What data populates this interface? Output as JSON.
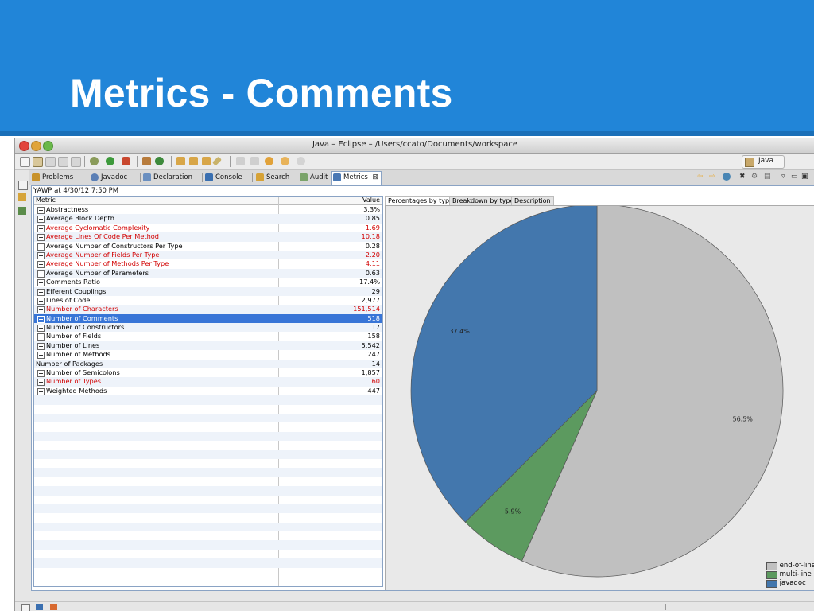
{
  "slide": {
    "title": "Metrics - Comments"
  },
  "window": {
    "title": "Java – Eclipse – /Users/ccato/Documents/workspace"
  },
  "perspective": {
    "label": "Java"
  },
  "tabs": [
    {
      "label": "Problems",
      "icon": "problems-icon",
      "color": "#c8922a"
    },
    {
      "label": "Javadoc",
      "icon": "javadoc-icon",
      "color": "#5b7fb5"
    },
    {
      "label": "Declaration",
      "icon": "declaration-icon",
      "color": "#6a8fc0"
    },
    {
      "label": "Console",
      "icon": "console-icon",
      "color": "#3a6fb0"
    },
    {
      "label": "Search",
      "icon": "search-icon",
      "color": "#d6a236"
    },
    {
      "label": "Audit",
      "icon": "audit-icon",
      "color": "#7aa36a"
    },
    {
      "label": "Metrics",
      "icon": "metrics-icon",
      "color": "#4a78b4"
    }
  ],
  "metrics": {
    "info": "YAWP at 4/30/12 7:50 PM",
    "columns": {
      "metric": "Metric",
      "value": "Value"
    },
    "rows": [
      {
        "name": "Abstractness",
        "value": "3.3%",
        "red": false,
        "expandable": true
      },
      {
        "name": "Average Block Depth",
        "value": "0.85",
        "red": false,
        "expandable": true
      },
      {
        "name": "Average Cyclomatic Complexity",
        "value": "1.69",
        "red": true,
        "expandable": true
      },
      {
        "name": "Average Lines Of Code Per Method",
        "value": "10.18",
        "red": true,
        "expandable": true
      },
      {
        "name": "Average Number of Constructors Per Type",
        "value": "0.28",
        "red": false,
        "expandable": true
      },
      {
        "name": "Average Number of Fields Per Type",
        "value": "2.20",
        "red": true,
        "expandable": true
      },
      {
        "name": "Average Number of Methods Per Type",
        "value": "4.11",
        "red": true,
        "expandable": true
      },
      {
        "name": "Average Number of Parameters",
        "value": "0.63",
        "red": false,
        "expandable": true
      },
      {
        "name": "Comments Ratio",
        "value": "17.4%",
        "red": false,
        "expandable": true
      },
      {
        "name": "Efferent Couplings",
        "value": "29",
        "red": false,
        "expandable": true
      },
      {
        "name": "Lines of Code",
        "value": "2,977",
        "red": false,
        "expandable": true
      },
      {
        "name": "Number of Characters",
        "value": "151,514",
        "red": true,
        "expandable": true
      },
      {
        "name": "Number of Comments",
        "value": "518",
        "red": false,
        "expandable": true,
        "selected": true
      },
      {
        "name": "Number of Constructors",
        "value": "17",
        "red": false,
        "expandable": true
      },
      {
        "name": "Number of Fields",
        "value": "158",
        "red": false,
        "expandable": true
      },
      {
        "name": "Number of Lines",
        "value": "5,542",
        "red": false,
        "expandable": true
      },
      {
        "name": "Number of Methods",
        "value": "247",
        "red": false,
        "expandable": true
      },
      {
        "name": "Number of Packages",
        "value": "14",
        "red": false,
        "expandable": false
      },
      {
        "name": "Number of Semicolons",
        "value": "1,857",
        "red": false,
        "expandable": true
      },
      {
        "name": "Number of Types",
        "value": "60",
        "red": true,
        "expandable": true
      },
      {
        "name": "Weighted Methods",
        "value": "447",
        "red": false,
        "expandable": true
      }
    ]
  },
  "chart_tabs": [
    "Percentages by type",
    "Breakdown by type",
    "Description"
  ],
  "chart_data": {
    "type": "pie",
    "slices": [
      {
        "name": "end-of-line",
        "value": 56.5,
        "label": "56.5%",
        "color": "#c0c0c0"
      },
      {
        "name": "multi-line",
        "value": 5.9,
        "label": "5.9%",
        "color": "#5c9a5f"
      },
      {
        "name": "javadoc",
        "value": 37.4,
        "label": "37.4%",
        "color": "#4377ad"
      }
    ],
    "legend_position": "bottom-right"
  }
}
